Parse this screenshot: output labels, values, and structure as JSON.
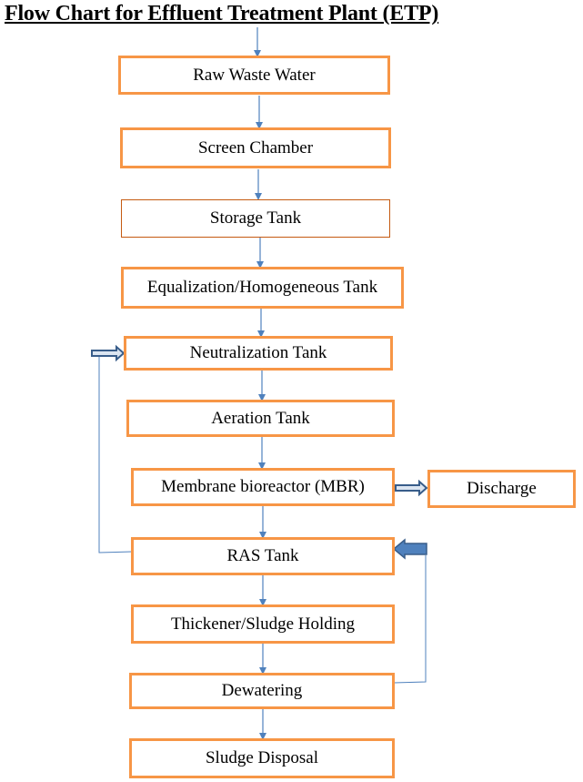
{
  "title": "Flow Chart for Effluent Treatment Plant (ETP)",
  "steps": [
    {
      "label": "Raw Waste Water"
    },
    {
      "label": "Screen Chamber"
    },
    {
      "label": "Storage Tank"
    },
    {
      "label": "Equalization/Homogeneous Tank"
    },
    {
      "label": "Neutralization Tank"
    },
    {
      "label": "Aeration Tank"
    },
    {
      "label": "Membrane bioreactor (MBR)"
    },
    {
      "label": "RAS Tank"
    },
    {
      "label": "Thickener/Sludge Holding"
    },
    {
      "label": "Dewatering"
    },
    {
      "label": "Sludge Disposal"
    }
  ],
  "side_outputs": {
    "discharge": {
      "label": "Discharge",
      "from": "Membrane bioreactor (MBR)"
    }
  },
  "feedback_loops": [
    {
      "from": "RAS Tank",
      "to": "Neutralization Tank"
    },
    {
      "from": "Dewatering",
      "to": "RAS Tank"
    }
  ],
  "colors": {
    "box_border": "#f79646",
    "connector": "#4f81bd",
    "block_arrow": "#4f81bd"
  }
}
